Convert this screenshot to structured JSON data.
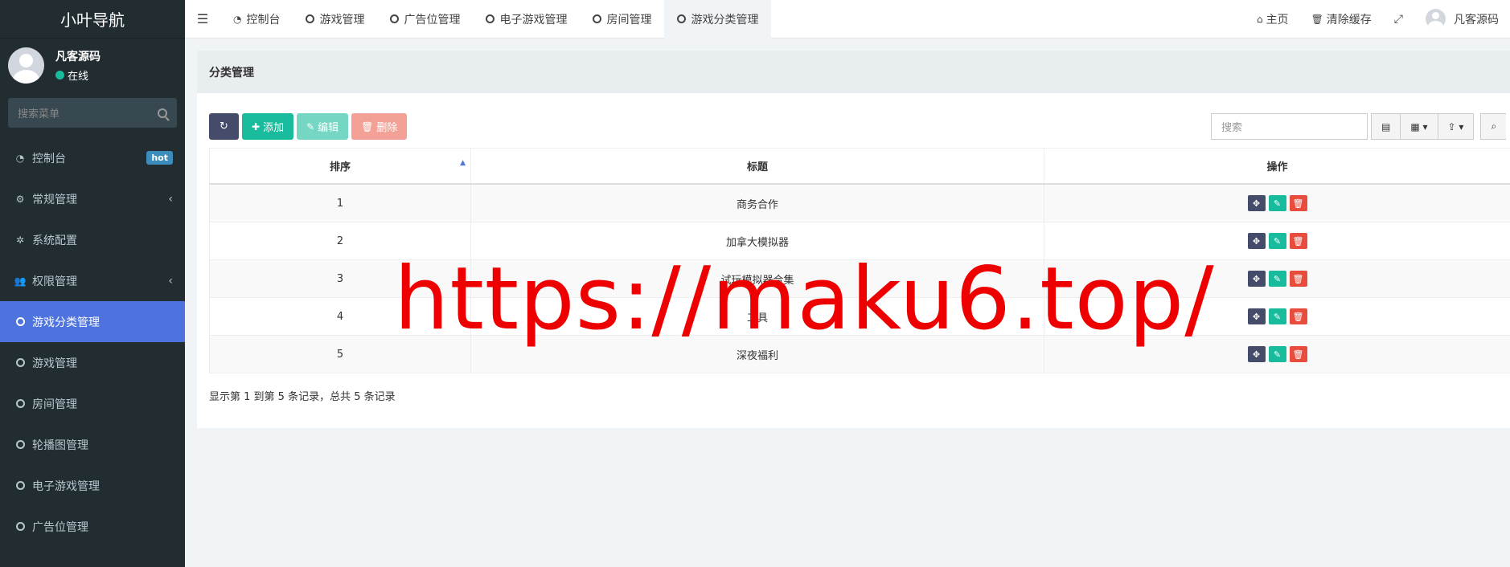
{
  "sidebar": {
    "logo": "小叶导航",
    "user": {
      "name": "凡客源码",
      "status": "在线"
    },
    "search_placeholder": "搜索菜单",
    "items": [
      {
        "label": "控制台",
        "icon": "dashboard-icon",
        "badge": "hot"
      },
      {
        "label": "常规管理",
        "icon": "cogs-icon",
        "chevron": "‹"
      },
      {
        "label": "系统配置",
        "icon": "cog-icon"
      },
      {
        "label": "权限管理",
        "icon": "users-icon",
        "chevron": "‹"
      },
      {
        "label": "游戏分类管理",
        "icon": "circle-icon",
        "active": true
      },
      {
        "label": "游戏管理",
        "icon": "circle-icon"
      },
      {
        "label": "房间管理",
        "icon": "circle-icon"
      },
      {
        "label": "轮播图管理",
        "icon": "circle-icon"
      },
      {
        "label": "电子游戏管理",
        "icon": "circle-icon"
      },
      {
        "label": "广告位管理",
        "icon": "circle-icon"
      }
    ]
  },
  "topbar": {
    "tabs": [
      {
        "label": "控制台",
        "icon": "dashboard-icon"
      },
      {
        "label": "游戏管理",
        "icon": "circle-icon"
      },
      {
        "label": "广告位管理",
        "icon": "circle-icon"
      },
      {
        "label": "电子游戏管理",
        "icon": "circle-icon"
      },
      {
        "label": "房间管理",
        "icon": "circle-icon"
      },
      {
        "label": "游戏分类管理",
        "icon": "circle-icon",
        "active": true
      }
    ],
    "home": "主页",
    "clear_cache": "清除缓存",
    "username": "凡客源码"
  },
  "panel": {
    "title": "分类管理",
    "buttons": {
      "add": "添加",
      "edit": "编辑",
      "delete": "删除"
    },
    "search_placeholder": "搜索",
    "table": {
      "headers": [
        "排序",
        "标题",
        "操作"
      ],
      "rows": [
        {
          "order": "1",
          "title": "商务合作"
        },
        {
          "order": "2",
          "title": "加拿大模拟器"
        },
        {
          "order": "3",
          "title": "试玩模拟器合集"
        },
        {
          "order": "4",
          "title": "工具"
        },
        {
          "order": "5",
          "title": "深夜福利"
        }
      ]
    },
    "pagination": "显示第 1 到第 5 条记录，总共 5 条记录"
  },
  "watermark": "https://maku6.top/",
  "colors": {
    "sidebar": "#222d32",
    "active": "#4e73df",
    "success": "#18bc9c",
    "danger": "#e74c3c",
    "dark": "#444c69"
  }
}
